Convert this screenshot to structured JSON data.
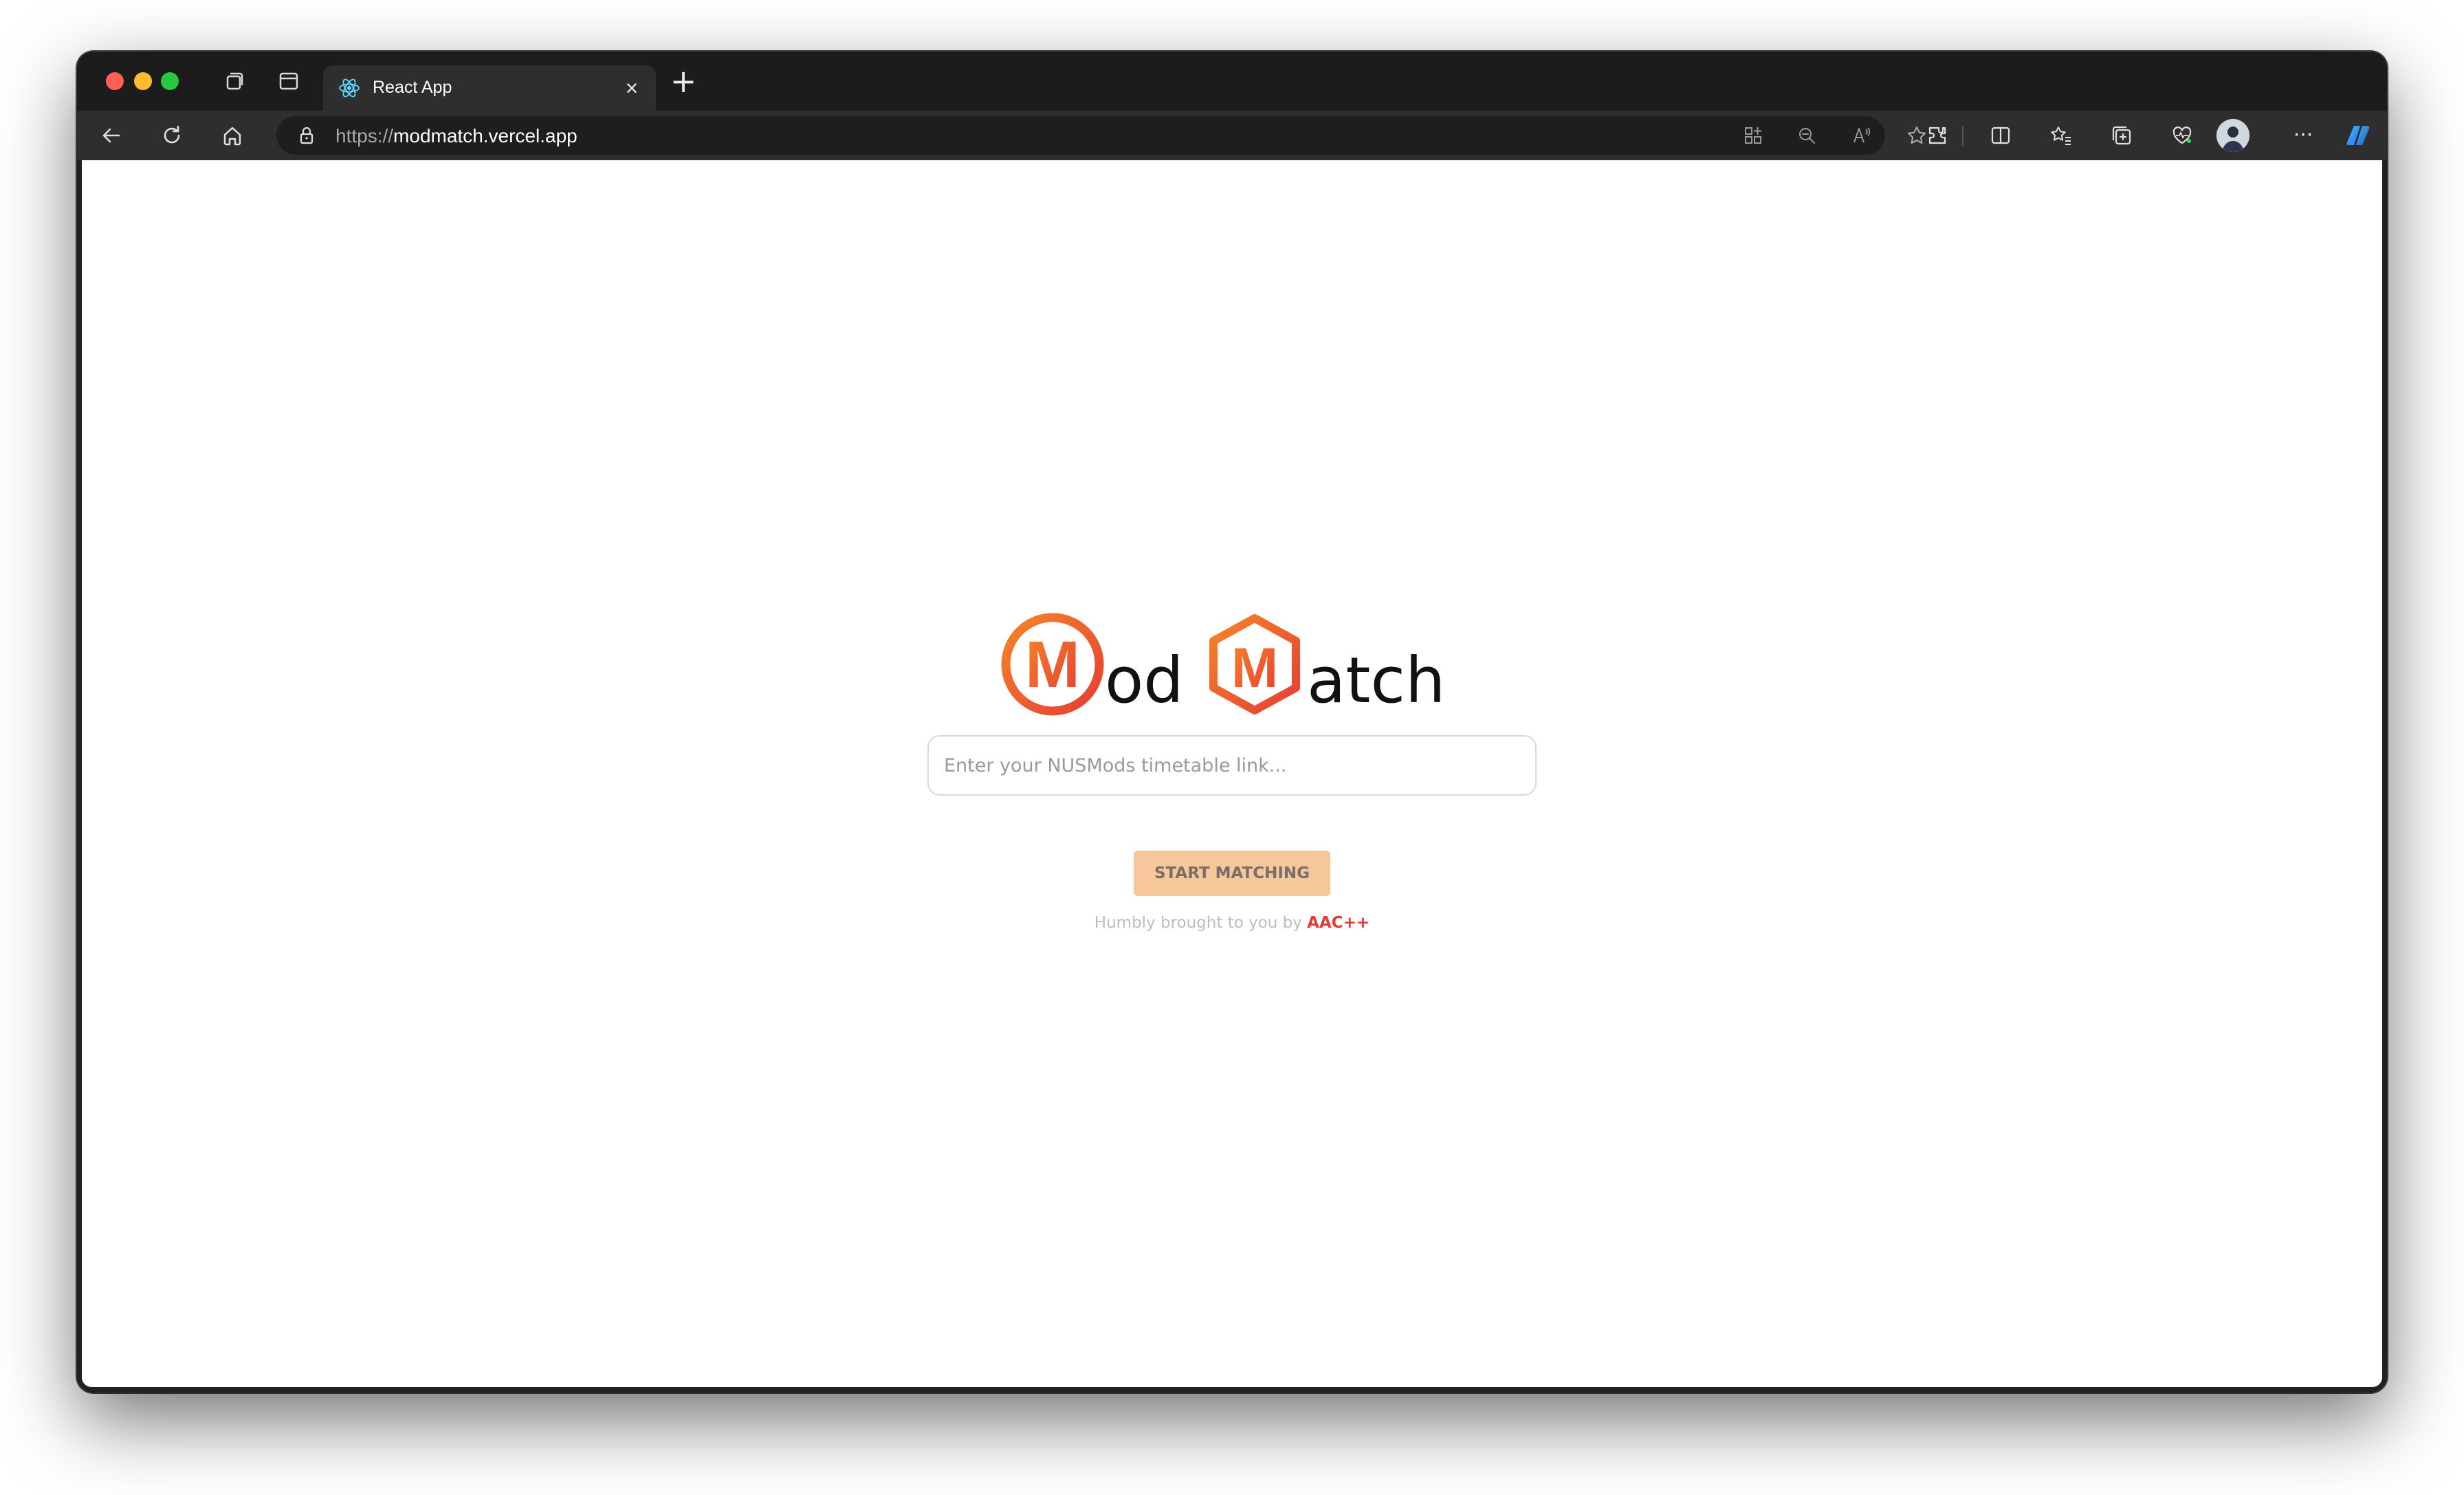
{
  "browser": {
    "tab": {
      "title": "React App",
      "close_glyph": "×",
      "favicon": "react-icon"
    },
    "new_tab_glyph": "+",
    "address": {
      "scheme": "https://",
      "host": "modmatch.vercel.app"
    },
    "toolbar_icons": [
      "back-arrow-icon",
      "refresh-icon",
      "home-icon",
      "lock-icon",
      "apps-icon",
      "zoom-out-icon",
      "read-aloud-icon",
      "favorite-star-icon",
      "extensions-icon",
      "split-screen-icon",
      "favorites-icon",
      "collections-icon",
      "browser-essentials-icon",
      "profile-avatar",
      "more-icon",
      "copilot-icon"
    ],
    "more_glyph": "···"
  },
  "page": {
    "logo": {
      "text_1": "od",
      "text_2": "atch",
      "letter": "M",
      "colors": {
        "start": "#f5842a",
        "end": "#e53e34",
        "text": "#111111"
      }
    },
    "search": {
      "placeholder": "Enter your NUSMods timetable link..."
    },
    "button_label": "START MATCHING",
    "credit": {
      "prefix": "Humbly brought to you by ",
      "brand": "AAC++"
    },
    "colors": {
      "button": "#f6c79a",
      "brand_red": "#e53935"
    }
  }
}
